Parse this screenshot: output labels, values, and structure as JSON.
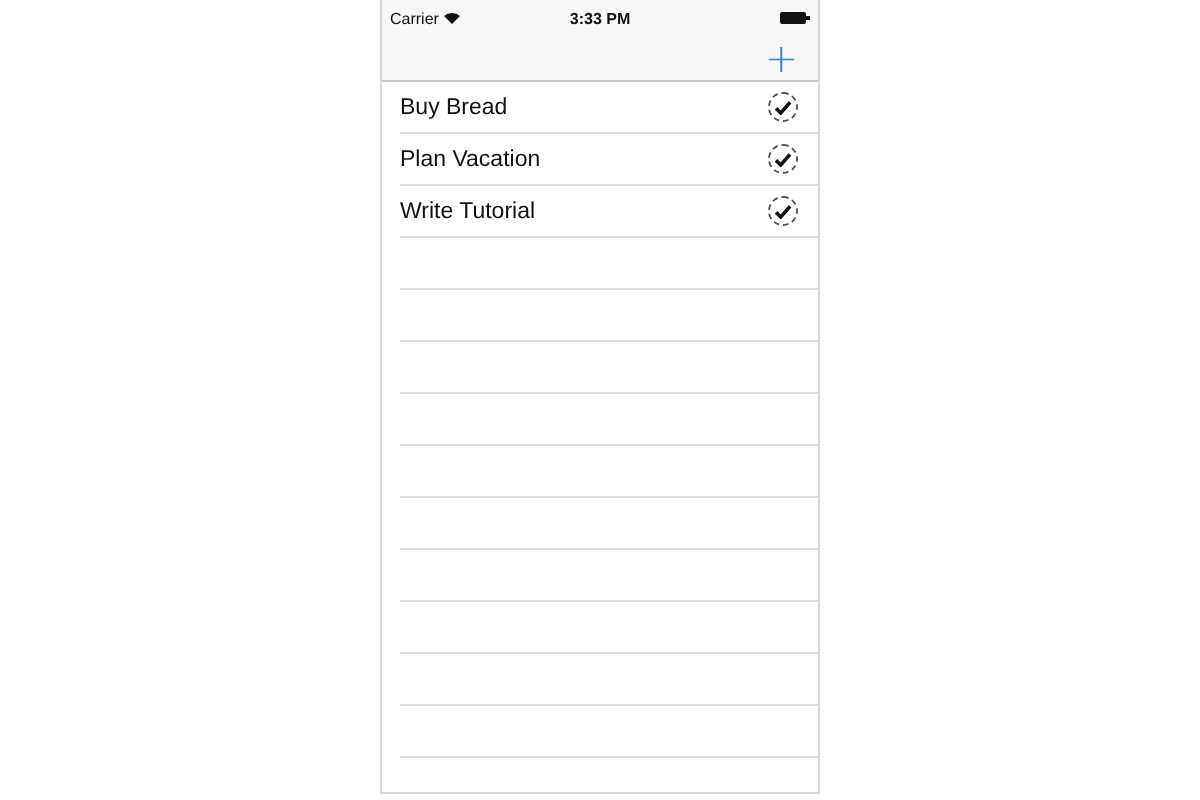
{
  "status_bar": {
    "carrier": "Carrier",
    "time": "3:33 PM"
  },
  "nav_bar": {
    "add_button": "+"
  },
  "todos": [
    {
      "title": "Buy Bread",
      "done": true
    },
    {
      "title": "Plan Vacation",
      "done": true
    },
    {
      "title": "Write Tutorial",
      "done": true
    }
  ]
}
